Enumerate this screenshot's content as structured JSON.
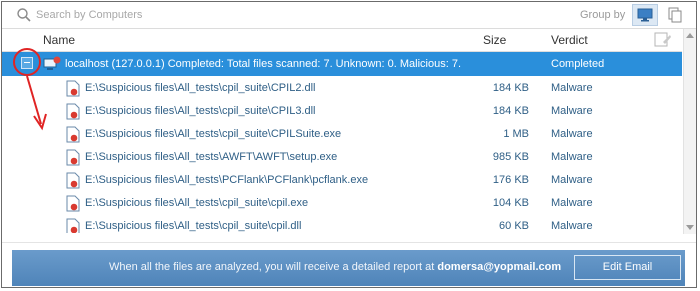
{
  "search": {
    "placeholder": "Search by Computers"
  },
  "groupby": {
    "label": "Group by"
  },
  "columns": {
    "name": "Name",
    "size": "Size",
    "verdict": "Verdict"
  },
  "host": {
    "label": "localhost (127.0.0.1)   Completed: Total files scanned: 7. Unknown: 0. Malicious: 7.",
    "verdict": "Completed"
  },
  "files": [
    {
      "path": "E:\\Suspicious files\\All_tests\\cpil_suite\\CPIL2.dll",
      "size": "184 KB",
      "verdict": "Malware"
    },
    {
      "path": "E:\\Suspicious files\\All_tests\\cpil_suite\\CPIL3.dll",
      "size": "184 KB",
      "verdict": "Malware"
    },
    {
      "path": "E:\\Suspicious files\\All_tests\\cpil_suite\\CPILSuite.exe",
      "size": "1 MB",
      "verdict": "Malware"
    },
    {
      "path": "E:\\Suspicious files\\All_tests\\AWFT\\AWFT\\setup.exe",
      "size": "985 KB",
      "verdict": "Malware"
    },
    {
      "path": "E:\\Suspicious files\\All_tests\\PCFlank\\PCFlank\\pcflank.exe",
      "size": "176 KB",
      "verdict": "Malware"
    },
    {
      "path": "E:\\Suspicious files\\All_tests\\cpil_suite\\cpil.exe",
      "size": "104 KB",
      "verdict": "Malware"
    },
    {
      "path": "E:\\Suspicious files\\All_tests\\cpil_suite\\cpil.dll",
      "size": "60 KB",
      "verdict": "Malware"
    }
  ],
  "footer": {
    "message": "When all the files are analyzed, you will receive a detailed report at ",
    "email": "domersa@yopmail.com",
    "button_label": "Edit Email"
  },
  "colors": {
    "selected_row": "#2a8fdb",
    "link_text": "#2f5f86",
    "annotation": "#e02424",
    "footer_bg": "#5a8ec2"
  }
}
